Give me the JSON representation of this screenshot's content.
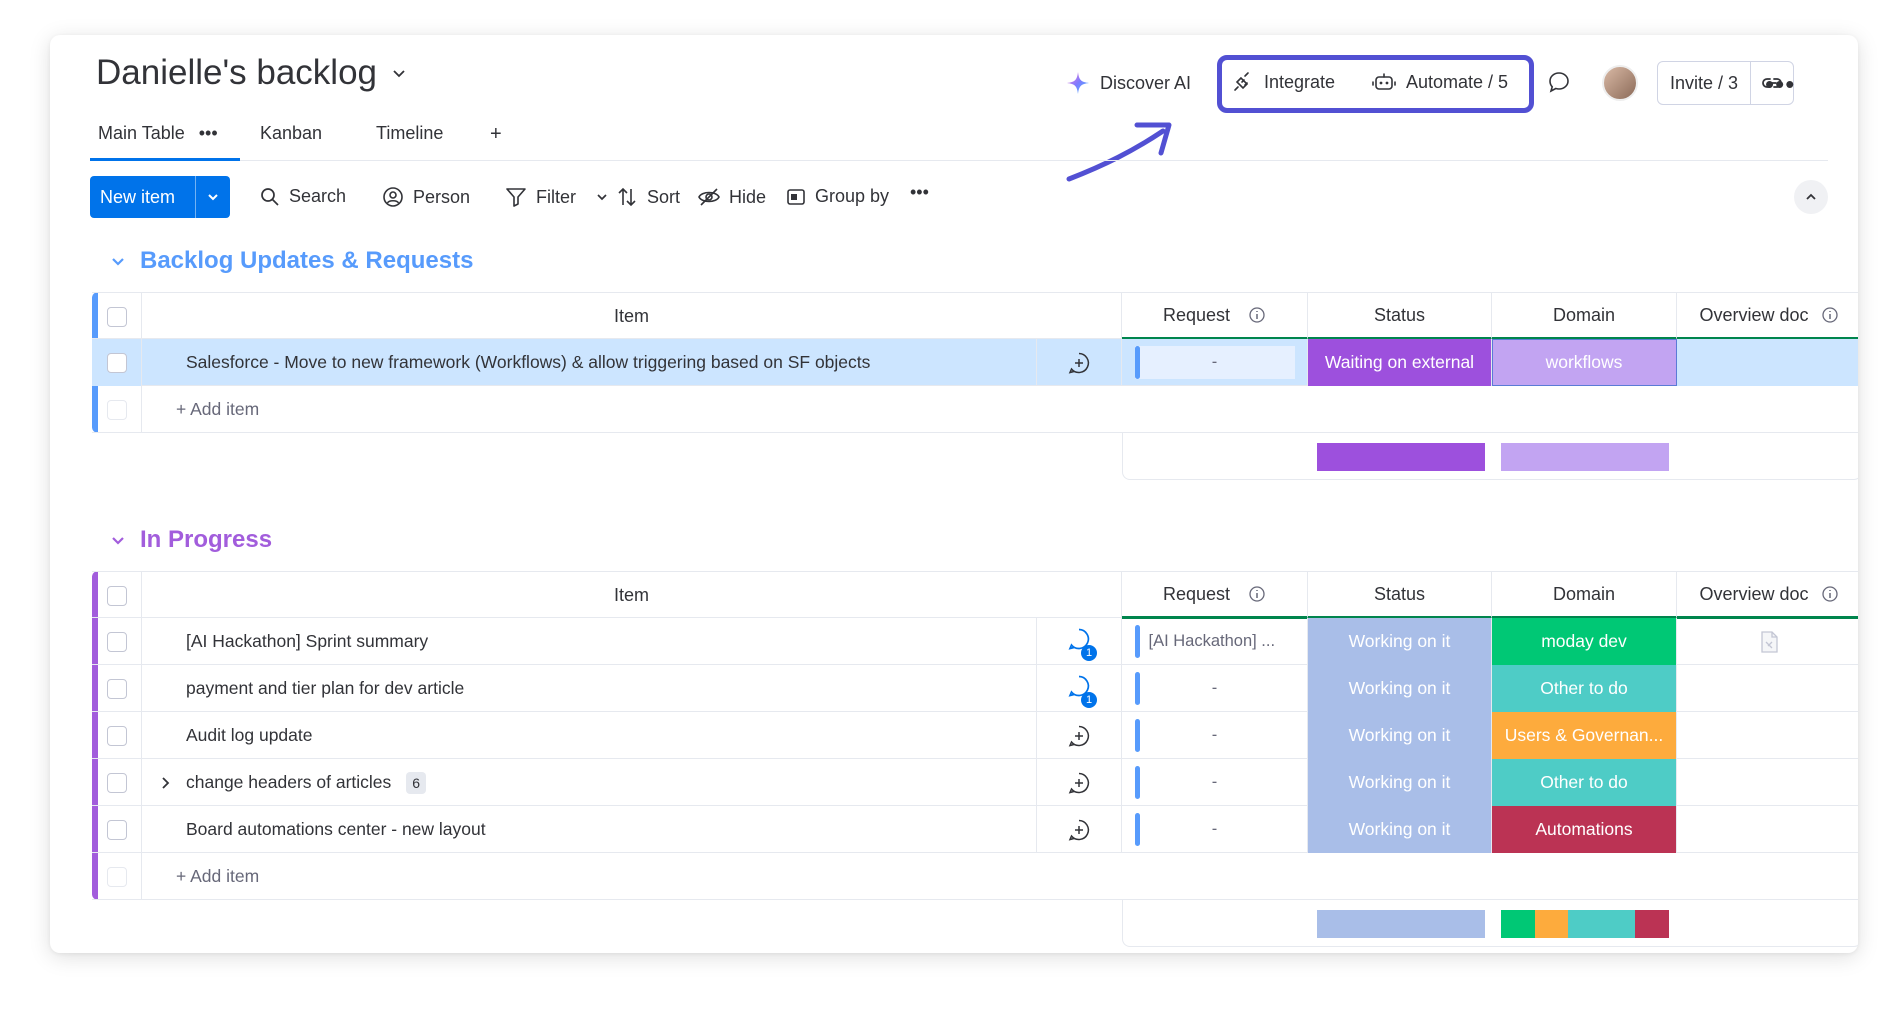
{
  "board": {
    "title": "Danielle's backlog"
  },
  "topbar": {
    "discover_ai": "Discover AI",
    "integrate": "Integrate",
    "automate": "Automate / 5",
    "invite": "Invite / 3",
    "highlight_color": "#5250d3"
  },
  "tabs": [
    {
      "label": "Main Table",
      "active": true
    },
    {
      "label": "Kanban"
    },
    {
      "label": "Timeline"
    }
  ],
  "toolbar": {
    "new_item": "New item",
    "search": "Search",
    "person": "Person",
    "filter": "Filter",
    "sort": "Sort",
    "hide": "Hide",
    "group_by": "Group by"
  },
  "columns": {
    "item": "Item",
    "request": "Request",
    "status": "Status",
    "domain": "Domain",
    "overview_doc": "Overview doc"
  },
  "groups": [
    {
      "title": "Backlog Updates & Requests",
      "color": "#579bfc",
      "add_item": "+ Add item",
      "rows": [
        {
          "item": "Salesforce - Move to new framework (Workflows) & allow triggering based on SF objects",
          "request": "-",
          "status": "Waiting on external",
          "status_color": "#9d50dd",
          "domain": "workflows",
          "domain_color": "#c2a4f2"
        }
      ],
      "summary_status": [
        {
          "color": "#9d50dd",
          "share": 1
        }
      ],
      "summary_domain": [
        {
          "color": "#c2a4f2",
          "share": 1
        }
      ]
    },
    {
      "title": "In Progress",
      "color": "#a25ddc",
      "add_item": "+ Add item",
      "rows": [
        {
          "item": "[AI Hackathon] Sprint summary",
          "request": "[AI Hackathon] ...",
          "status": "Working on it",
          "domain": "moday dev",
          "domain_color": "#00c875",
          "updates": "1"
        },
        {
          "item": "payment and tier plan for dev article",
          "request": "-",
          "status": "Working on it",
          "domain": "Other to do",
          "domain_color": "#4eccc6",
          "updates": "1"
        },
        {
          "item": "Audit log update",
          "request": "-",
          "status": "Working on it",
          "domain": "Users & Governan...",
          "domain_color": "#fdab3d"
        },
        {
          "item": "change headers of articles",
          "subitems": "6",
          "request": "-",
          "status": "Working on it",
          "domain": "Other to do",
          "domain_color": "#4eccc6"
        },
        {
          "item": "Board automations center - new layout",
          "request": "-",
          "status": "Working on it",
          "domain": "Automations",
          "domain_color": "#bb3354"
        }
      ],
      "status_color": "#a9bee8",
      "summary_status": [
        {
          "color": "#a9bee8",
          "share": 1
        }
      ],
      "summary_domain": [
        {
          "color": "#00c875",
          "share": 0.2
        },
        {
          "color": "#fdab3d",
          "share": 0.2
        },
        {
          "color": "#4eccc6",
          "share": 0.4
        },
        {
          "color": "#bb3354",
          "share": 0.2
        }
      ]
    }
  ]
}
